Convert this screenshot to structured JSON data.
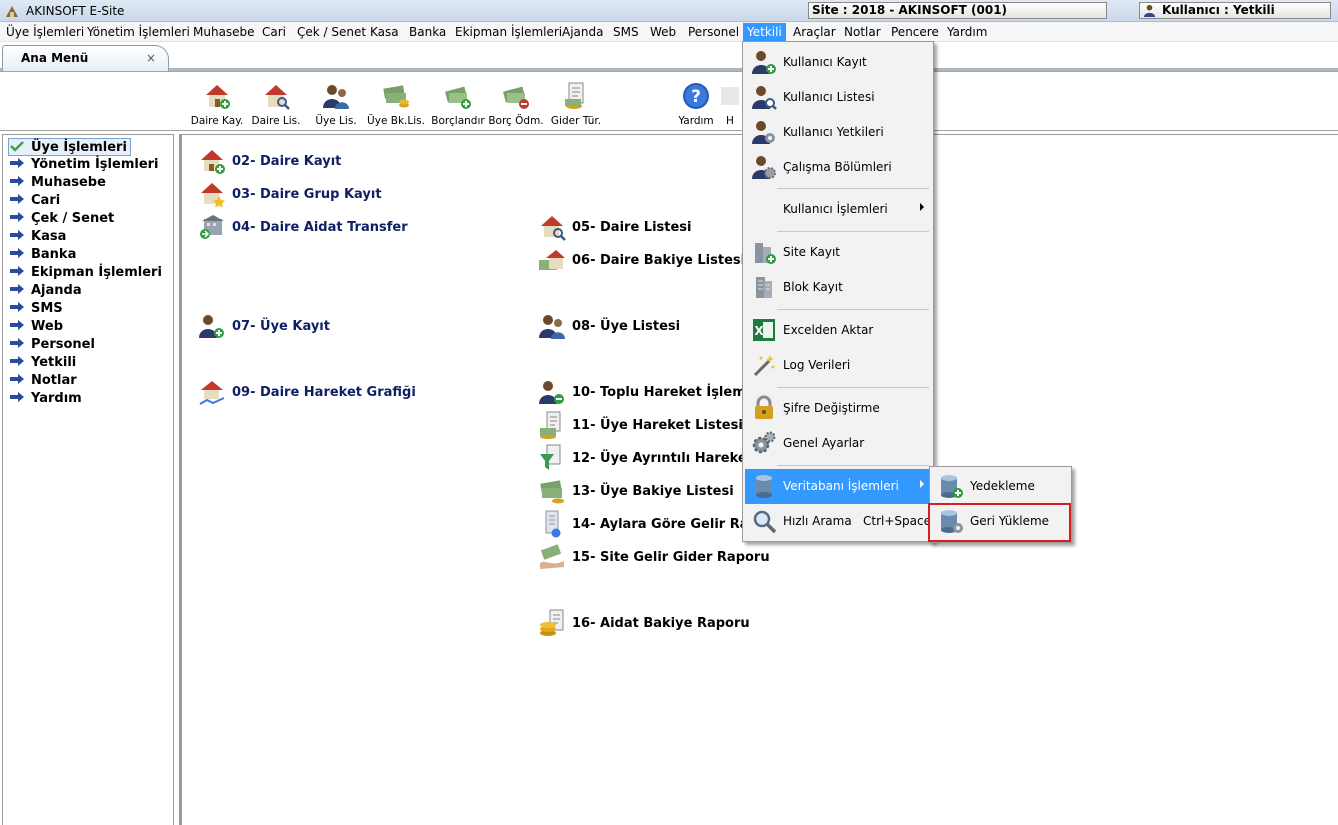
{
  "window": {
    "title": "AKINSOFT E-Site",
    "site": "Site : 2018 - AKINSOFT (001)",
    "user": "Kullanıcı : Yetkili"
  },
  "menubar": [
    "Üye İşlemleri",
    "Yönetim İşlemleri",
    "Muhasebe",
    "Cari",
    "Çek / Senet",
    "Kasa",
    "Banka",
    "Ekipman İşlemleri",
    "Ajanda",
    "SMS",
    "Web",
    "Personel",
    "Yetkili",
    "Araçlar",
    "Notlar",
    "Pencere",
    "Yardım"
  ],
  "active_menu": "Yetkili",
  "tab": {
    "label": "Ana Menü",
    "close": "×"
  },
  "toolbar": [
    "Daire Kay.",
    "Daire Lis.",
    "Üye Lis.",
    "Üye Bk.Lis.",
    "Borçlandır",
    "Borç Ödm.",
    "Gider Tür.",
    "Yardım",
    "H"
  ],
  "sidebar": {
    "selected": "Üye İşlemleri",
    "items": [
      "Üye İşlemleri",
      "Yönetim İşlemleri",
      "Muhasebe",
      "Cari",
      "Çek / Senet",
      "Kasa",
      "Banka",
      "Ekipman İşlemleri",
      "Ajanda",
      "SMS",
      "Web",
      "Personel",
      "Yetkili",
      "Notlar",
      "Yardım"
    ]
  },
  "content": {
    "items": [
      "02- Daire Kayıt",
      "03- Daire Grup Kayıt",
      "04- Daire Aidat Transfer",
      "05- Daire Listesi",
      "06- Daire Bakiye Listesi",
      "07- Üye Kayıt",
      "08- Üye Listesi",
      "09- Daire Hareket Grafiği",
      "10- Toplu Hareket İşlemler",
      "11- Üye Hareket Listesi",
      "12- Üye Ayrıntılı Hareket Li",
      "13- Üye Bakiye Listesi",
      "14- Aylara Göre Gelir Rapo",
      "15- Site Gelir Gider Raporu",
      "16- Aidat Bakiye Raporu"
    ]
  },
  "dropdown": {
    "items": [
      "Kullanıcı Kayıt",
      "Kullanıcı Listesi",
      "Kullanıcı Yetkileri",
      "Çalışma Bölümleri",
      "Kullanıcı İşlemleri",
      "Site Kayıt",
      "Blok Kayıt",
      "Excelden Aktar",
      "Log Verileri",
      "Şifre Değiştirme",
      "Genel Ayarlar",
      "Veritabanı İşlemleri",
      "Hızlı Arama"
    ],
    "shortcut": "Ctrl+Space",
    "highlighted": "Veritabanı İşlemleri"
  },
  "submenu": {
    "items": [
      "Yedekleme",
      "Geri Yükleme"
    ],
    "marked": "Geri Yükleme"
  },
  "colors": {
    "menu_highlight": "#3399ff",
    "link_text": "#0f1f63",
    "marker": "#d42020"
  }
}
